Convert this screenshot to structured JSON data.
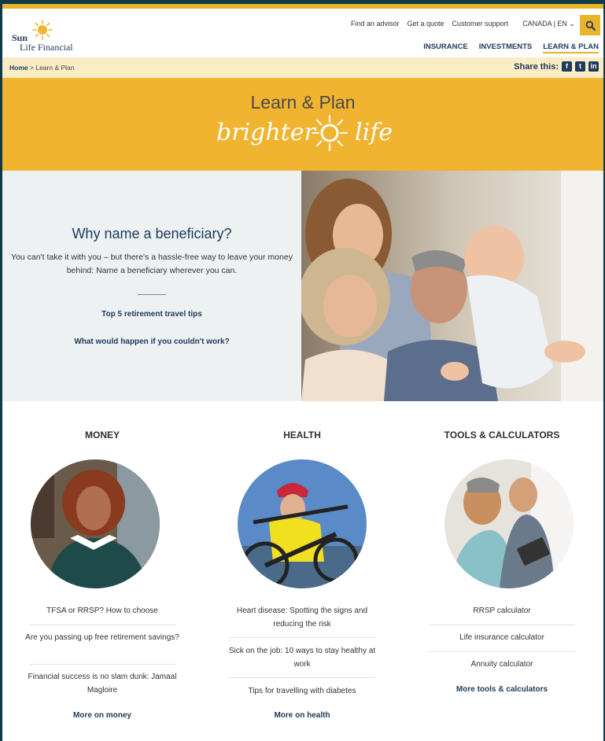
{
  "logo": {
    "line1": "Sun",
    "line2": "Life Financial"
  },
  "util_nav": {
    "find_advisor": "Find an advisor",
    "get_quote": "Get a quote",
    "support": "Customer support",
    "locale": "CANADA | EN"
  },
  "main_nav": {
    "insurance": "INSURANCE",
    "investments": "INVESTMENTS",
    "learn_plan": "LEARN & PLAN"
  },
  "breadcrumb": {
    "home": "Home",
    "separator": ">",
    "current": "Learn & Plan"
  },
  "share": {
    "label": "Share this:",
    "facebook": "f",
    "twitter": "t",
    "linkedin": "in"
  },
  "banner": {
    "title": "Learn & Plan",
    "tagline_left": "brighter",
    "tagline_right": "life"
  },
  "hero": {
    "title": "Why name a beneficiary?",
    "description": "You can't take it with you – but there's a hassle-free way to leave your money behind: Name a beneficiary wherever you can.",
    "link1": "Top 5 retirement travel tips",
    "link2": "What would happen if you couldn't work?"
  },
  "columns": {
    "money": {
      "heading": "MONEY",
      "items": [
        "TFSA or RRSP? How to choose",
        "Are you passing up free retirement savings?",
        "Financial success is no slam dunk: Jamaal Magloire"
      ],
      "more": "More on money"
    },
    "health": {
      "heading": "HEALTH",
      "items": [
        "Heart disease: Spotting the signs and reducing the risk",
        "Sick on the job: 10 ways to stay healthy at work",
        "Tips for travelling with diabetes"
      ],
      "more": "More on health"
    },
    "tools": {
      "heading": "TOOLS & CALCULATORS",
      "items": [
        "RRSP calculator",
        "Life insurance calculator",
        "Annuity calculator"
      ],
      "more": "More tools & calculators"
    }
  },
  "colors": {
    "brand_yellow": "#f0b430",
    "navy": "#1f3a5a",
    "cream": "#faecc4",
    "frame": "#0e3a4a"
  }
}
